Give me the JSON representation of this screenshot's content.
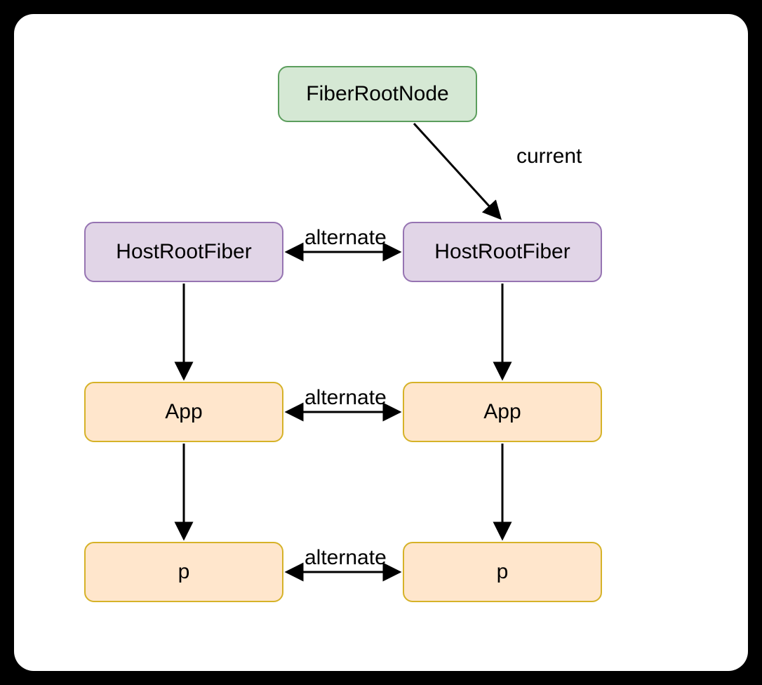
{
  "nodes": {
    "fiberRootNode": {
      "label": "FiberRootNode"
    },
    "hostRootFiberLeft": {
      "label": "HostRootFiber"
    },
    "hostRootFiberRight": {
      "label": "HostRootFiber"
    },
    "appLeft": {
      "label": "App"
    },
    "appRight": {
      "label": "App"
    },
    "pLeft": {
      "label": "p"
    },
    "pRight": {
      "label": "p"
    }
  },
  "edges": {
    "current": {
      "label": "current"
    },
    "alternate1": {
      "label": "alternate"
    },
    "alternate2": {
      "label": "alternate"
    },
    "alternate3": {
      "label": "alternate"
    }
  }
}
